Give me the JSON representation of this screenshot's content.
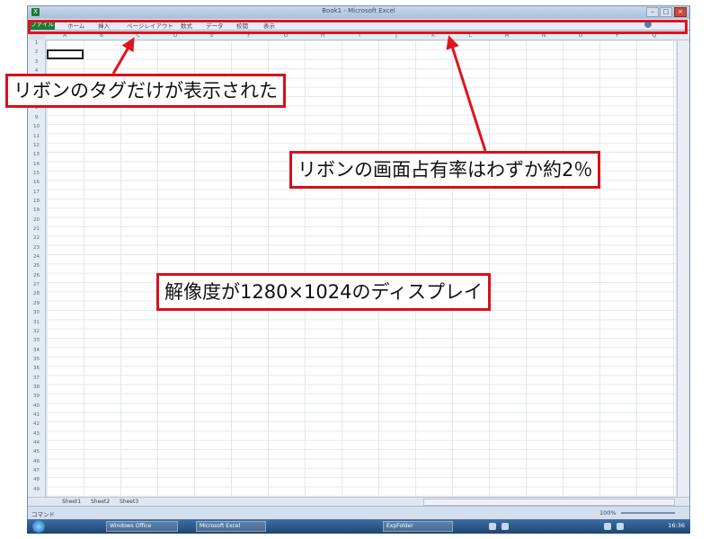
{
  "window": {
    "title": "Book1 - Microsoft Excel",
    "app_icon": "X",
    "controls": [
      "–",
      "□",
      "×"
    ]
  },
  "ribbon": {
    "tabs": [
      "ファイル",
      "ホーム",
      "挿入",
      "ページレイアウト",
      "数式",
      "データ",
      "校閲",
      "表示"
    ]
  },
  "grid": {
    "columns": [
      "A",
      "B",
      "C",
      "D",
      "E",
      "F",
      "G",
      "H",
      "I",
      "J",
      "K",
      "L",
      "M",
      "N",
      "O",
      "P",
      "Q"
    ],
    "rows": [
      "1",
      "2",
      "3",
      "4",
      "5",
      "6",
      "7",
      "8",
      "9",
      "10",
      "11",
      "12",
      "13",
      "14",
      "15",
      "16",
      "17",
      "18",
      "19",
      "20",
      "21",
      "22",
      "23",
      "24",
      "25",
      "26",
      "27",
      "28",
      "29",
      "30",
      "31",
      "32",
      "33",
      "34",
      "35",
      "36",
      "37",
      "38",
      "39",
      "40",
      "41",
      "42",
      "43",
      "44",
      "45",
      "46",
      "47",
      "48",
      "49"
    ]
  },
  "sheets": [
    "Sheet1",
    "Sheet2",
    "Sheet3"
  ],
  "status": {
    "ready": "コマンド",
    "zoom": "100%"
  },
  "taskbar": {
    "buttons": [
      "Windows Office",
      "Microsoft Excel",
      "ExpFolder"
    ],
    "clock": "16:36"
  },
  "annotations": {
    "tags": "リボンのタグだけが表示された",
    "ratio": "リボンの画面占有率はわずか約2％",
    "resolution": "解像度が1280×1024のディスプレイ"
  },
  "colors": {
    "annotation_red": "#d81018",
    "file_tab_green": "#1f7a3a"
  }
}
